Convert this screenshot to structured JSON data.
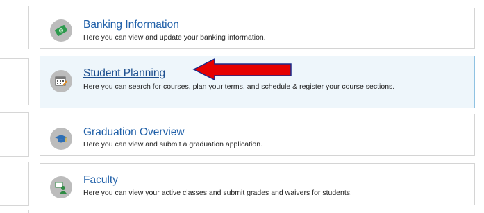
{
  "cards": [
    {
      "title": "Banking Information",
      "description": "Here you can view and update your banking information.",
      "icon": "money-icon"
    },
    {
      "title": "Student Planning",
      "description": "Here you can search for courses, plan your terms, and schedule & register your course sections.",
      "icon": "calendar-icon"
    },
    {
      "title": "Graduation Overview",
      "description": "Here you can view and submit a graduation application.",
      "icon": "graduation-cap-icon"
    },
    {
      "title": "Faculty",
      "description": "Here you can view your active classes and submit grades and waivers for students.",
      "icon": "faculty-icon"
    }
  ],
  "colors": {
    "link": "#1f5fa8",
    "highlight_background": "#eef6fb",
    "highlight_border": "#8fc2e2",
    "annotation_arrow": "#e60000",
    "icon_circle": "#bcbcbc"
  }
}
